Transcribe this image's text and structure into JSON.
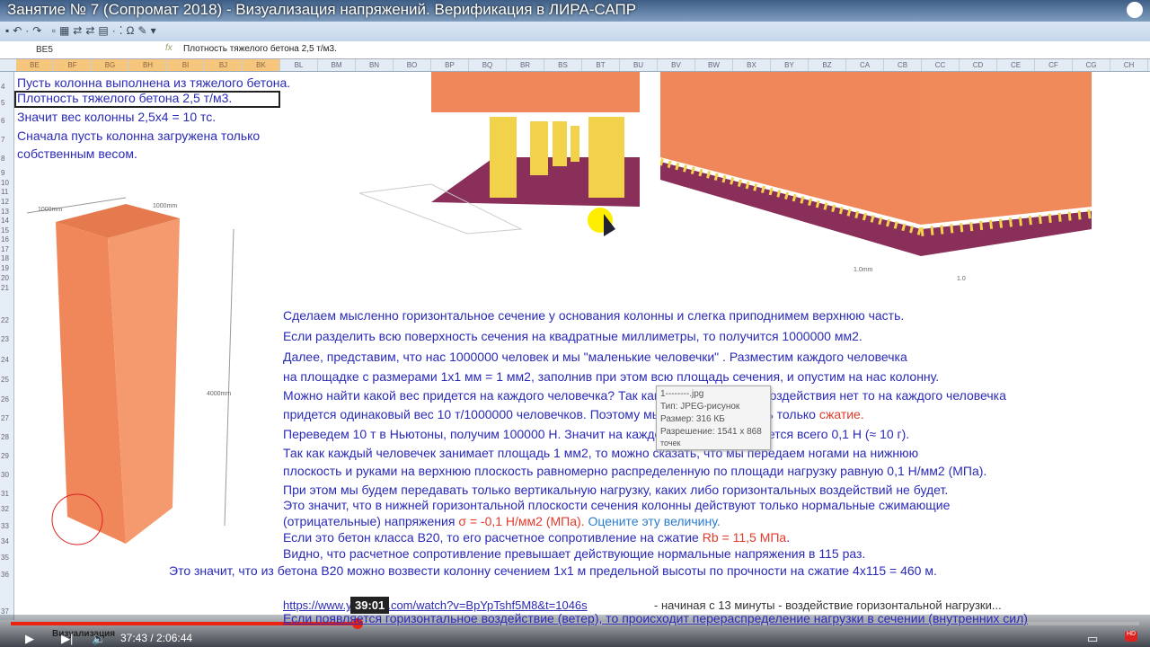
{
  "video": {
    "title": "Занятие № 7 (Сопромат 2018) - Визуализация напряжений. Верификация в ЛИРА-САПР",
    "hover_time": "39:01",
    "time": "37:43 / 2:06:44",
    "progress_fraction": 0.3,
    "hd": "HD"
  },
  "excel": {
    "name_box": "BE5",
    "fx": "fx",
    "formula": "Плотность тяжелого бетона 2,5 т/м3.",
    "sheet_tab": "Визуализация",
    "columns": [
      "BE",
      "BF",
      "BG",
      "BH",
      "BI",
      "BJ",
      "BK",
      "BL",
      "BM",
      "BN",
      "BO",
      "BP",
      "BQ",
      "BR",
      "BS",
      "BT",
      "BU",
      "BV",
      "BW",
      "BX",
      "BY",
      "BZ",
      "CA",
      "CB",
      "CC",
      "CD",
      "CE",
      "CF",
      "CG",
      "CH"
    ],
    "rows": [
      "4",
      "5",
      "6",
      "7",
      "8",
      "9",
      "10",
      "11",
      "12",
      "13",
      "14",
      "15",
      "16",
      "17",
      "18",
      "19",
      "20",
      "21",
      "22",
      "23",
      "24",
      "25",
      "26",
      "27",
      "28",
      "29",
      "30",
      "31",
      "32",
      "33",
      "34",
      "35",
      "36",
      "37"
    ]
  },
  "left_text": [
    "Пусть колонна выполнена из тяжелого бетона.",
    "Плотность тяжелого бетона 2,5 т/м3.",
    "Значит вес колонны 2,5х4 = 10 тс.",
    "Сначала пусть колонна загружена только",
    "собственным весом."
  ],
  "dims": {
    "a": "1000mm",
    "b": "1000mm",
    "h": "4000mm",
    "c": "1.0",
    "d": "1.0mm"
  },
  "lines": [
    [
      {
        "t": "Сделаем мысленно горизонтальное сечение у основания колонны и слегка приподнимем верхнюю часть."
      }
    ],
    [
      {
        "t": "Если разделить всю поверхность сечения на квадратные миллиметры, то получится 1000000 мм2."
      }
    ],
    [
      {
        "t": "Далее, представим, что нас 1000000 человек и мы \"маленькие человечки\" . Разместим каждого человечка"
      }
    ],
    [
      {
        "t": "на площадке с размерами 1х1 мм = 1 мм2, заполнив при этом всю площадь сечения,  и опустим на нас колонну."
      }
    ],
    [
      {
        "t": "Можно найти какой вес придется на каждого человечка? Так как горизонтального воздействия нет то на каждого человечка"
      }
    ],
    [
      {
        "t": "придется одинаковый вес  10 т/1000000 человечков. Поэтому мы будем испытывать только "
      },
      {
        "t": "сжатие.",
        "c": "red"
      }
    ],
    [
      {
        "t": "Переведем 10 т в Ньютоны, получим 100000 Н. Значит на каждого человечка придется всего 0,1 Н (≈ 10 г)."
      }
    ],
    [
      {
        "t": "Так как каждый человечек занимает площадь 1 мм2, то можно сказать, что мы передаем ногами на нижнюю"
      }
    ],
    [
      {
        "t": "плоскость и руками на верхнюю плоскость равномерно распределенную по площади нагрузку равную 0,1 Н/мм2  (МПа)."
      }
    ],
    [
      {
        "t": "При этом мы будем передавать только вертикальную нагрузку, каких либо горизонтальных воздействий не будет."
      }
    ],
    [
      {
        "t": "Это значит, что в нижней горизонтальной плоскости сечения колонны действуют только нормальные сжимающие"
      }
    ],
    [
      {
        "t": "(отрицательные) напряжения "
      },
      {
        "t": "σ = -0,1 Н/мм2 (МПа).",
        "c": "red"
      },
      {
        "t": "  Оцените эту величину.",
        "c": "teal"
      }
    ],
    [
      {
        "t": "Если это бетон класса В20, то его расчетное сопротивление на сжатие "
      },
      {
        "t": "Rb = 11,5 МПа",
        "c": "red"
      },
      {
        "t": "."
      }
    ],
    [
      {
        "t": "Видно, что расчетное сопротивление превышает действующие нормальные напряжения в 115 раз."
      }
    ],
    [
      {
        "t": "Это значит, что из бетона В20 можно возвести колонну сечением 1х1 м предельной высоты по прочности на сжатие 4х115 = 460 м."
      }
    ]
  ],
  "link": {
    "url": "https://www.youtube.com/watch?v=BpYpTshf5M8&t=1046s",
    "note": "-  начиная с 13 минуты - воздействие горизонтальной нагрузки..."
  },
  "last_line": "Если появляется горизонтальное воздействие (ветер), то происходит перераспределение нагрузки в сечении (внутренних сил)",
  "tooltip": {
    "name": "1--------.jpg",
    "type": "Тип: JPEG-рисунок",
    "size": "Размер: 316 КБ",
    "res": "Разрешение: 1541 x 868",
    "res2": "точек"
  },
  "colors": {
    "concrete": "#f0875a",
    "slab": "#8a2e5a",
    "figure": "#f2d24a",
    "text": "#2a2ab8",
    "red": "#e23a2a"
  }
}
